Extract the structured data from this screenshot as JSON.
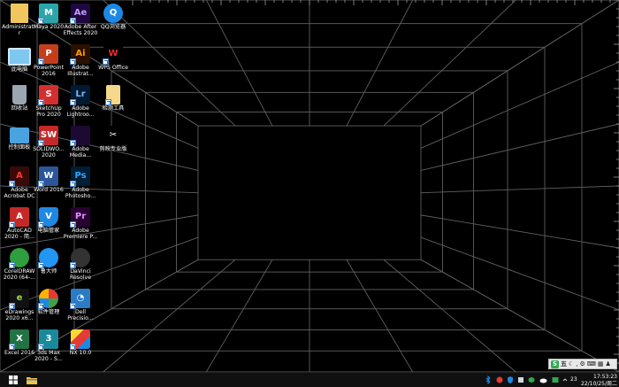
{
  "desktop": {
    "icons": [
      {
        "id": "administrator",
        "label": "Administrato\nr",
        "glyph": "",
        "bg": "#f0c75e",
        "fg": "#5a3a10",
        "shape": "folder-user",
        "col": 0,
        "row": 0,
        "shortcut": false
      },
      {
        "id": "maya",
        "label": "Maya 2020",
        "glyph": "M",
        "bg": "#2aa6a8",
        "fg": "#ffffff",
        "shape": "tile",
        "col": 1,
        "row": 0,
        "shortcut": true
      },
      {
        "id": "after-effects",
        "label": "Adobe After\nEffects 2020",
        "glyph": "Ae",
        "bg": "#1f0740",
        "fg": "#c49cff",
        "shape": "tile",
        "col": 2,
        "row": 0,
        "shortcut": true
      },
      {
        "id": "qq-browser",
        "label": "QQ浏览器",
        "glyph": "Q",
        "bg": "#1e88e5",
        "fg": "#ffffff",
        "shape": "round",
        "col": 3,
        "row": 0,
        "shortcut": false
      },
      {
        "id": "this-pc",
        "label": "此电脑",
        "glyph": "",
        "bg": "#7ec8f0",
        "fg": "#1c4f7a",
        "shape": "monitor",
        "col": 0,
        "row": 1,
        "shortcut": false
      },
      {
        "id": "powerpoint",
        "label": "PowerPoint\n2016",
        "glyph": "P",
        "bg": "#c43e1c",
        "fg": "#ffffff",
        "shape": "tile",
        "col": 1,
        "row": 1,
        "shortcut": true
      },
      {
        "id": "illustrator",
        "label": "Adobe\nIllustrat...",
        "glyph": "Ai",
        "bg": "#2b1000",
        "fg": "#ff9a00",
        "shape": "tile",
        "col": 2,
        "row": 1,
        "shortcut": true
      },
      {
        "id": "wps-office",
        "label": "WPS Office",
        "glyph": "W",
        "bg": "#000000",
        "fg": "#e5322d",
        "shape": "tile",
        "col": 3,
        "row": 1,
        "shortcut": true
      },
      {
        "id": "recycle-bin",
        "label": "回收站",
        "glyph": "",
        "bg": "#9aa6b2",
        "fg": "#3a4450",
        "shape": "bin",
        "col": 0,
        "row": 2,
        "shortcut": false
      },
      {
        "id": "sketchup",
        "label": "SketchUp\nPro 2020",
        "glyph": "S",
        "bg": "#d32f2f",
        "fg": "#ffffff",
        "shape": "tile",
        "col": 1,
        "row": 2,
        "shortcut": true
      },
      {
        "id": "lightroom",
        "label": "Adobe\nLightroo...",
        "glyph": "Lr",
        "bg": "#001a33",
        "fg": "#7ab8ff",
        "shape": "tile",
        "col": 2,
        "row": 2,
        "shortcut": true
      },
      {
        "id": "network-tool",
        "label": "检测工具",
        "glyph": "",
        "bg": "#f5d88a",
        "fg": "#7a5a10",
        "shape": "doc",
        "col": 3,
        "row": 2,
        "shortcut": true
      },
      {
        "id": "control-panel",
        "label": "控制面板",
        "glyph": "",
        "bg": "#4aa3df",
        "fg": "#ffffff",
        "shape": "panel",
        "col": 0,
        "row": 3,
        "shortcut": false
      },
      {
        "id": "solidworks",
        "label": "SOLIDWO...\n2020",
        "glyph": "SW",
        "bg": "#c62828",
        "fg": "#ffffff",
        "shape": "tile",
        "col": 1,
        "row": 3,
        "shortcut": true
      },
      {
        "id": "media-encoder",
        "label": "Adobe\nMedia...",
        "glyph": "",
        "bg": "#1d0a33",
        "fg": "#a88cff",
        "shape": "tile",
        "col": 2,
        "row": 3,
        "shortcut": true
      },
      {
        "id": "capcut",
        "label": "剪映专业版",
        "glyph": "✂",
        "bg": "#000000",
        "fg": "#ffffff",
        "shape": "tile",
        "col": 3,
        "row": 3,
        "shortcut": false
      },
      {
        "id": "acrobat",
        "label": "Adobe\nAcrobat DC",
        "glyph": "A",
        "bg": "#3a0a0a",
        "fg": "#ff3b30",
        "shape": "tile",
        "col": 0,
        "row": 4,
        "shortcut": true
      },
      {
        "id": "word",
        "label": "Word 2016",
        "glyph": "W",
        "bg": "#2b579a",
        "fg": "#ffffff",
        "shape": "tile",
        "col": 1,
        "row": 4,
        "shortcut": true
      },
      {
        "id": "photoshop",
        "label": "Adobe\nPhotosho...",
        "glyph": "Ps",
        "bg": "#001e36",
        "fg": "#31a8ff",
        "shape": "tile",
        "col": 2,
        "row": 4,
        "shortcut": true
      },
      {
        "id": "autocad",
        "label": "AutoCAD\n2020 - 简...",
        "glyph": "A",
        "bg": "#c62828",
        "fg": "#ffffff",
        "shape": "tile",
        "col": 0,
        "row": 5,
        "shortcut": true
      },
      {
        "id": "pc-manager",
        "label": "电脑管家",
        "glyph": "V",
        "bg": "#1e88e5",
        "fg": "#ffffff",
        "shape": "shield",
        "col": 1,
        "row": 5,
        "shortcut": true
      },
      {
        "id": "premiere",
        "label": "Adobe\nPremiere P...",
        "glyph": "Pr",
        "bg": "#2a0033",
        "fg": "#e38cff",
        "shape": "tile",
        "col": 2,
        "row": 5,
        "shortcut": true
      },
      {
        "id": "coreldraw",
        "label": "CorelDRAW\n2020 (64-...",
        "glyph": "",
        "bg": "#2e9e3e",
        "fg": "#ffffff",
        "shape": "round",
        "col": 0,
        "row": 6,
        "shortcut": true
      },
      {
        "id": "ludashi",
        "label": "鲁大师",
        "glyph": "",
        "bg": "#2196f3",
        "fg": "#ffffff",
        "shape": "round",
        "col": 1,
        "row": 6,
        "shortcut": true
      },
      {
        "id": "davinci",
        "label": "DaVinci\nResolve",
        "glyph": "",
        "bg": "#333333",
        "fg": "#ffffff",
        "shape": "round",
        "col": 2,
        "row": 6,
        "shortcut": true
      },
      {
        "id": "edrawings",
        "label": "eDrawings\n2020 x6...",
        "glyph": "e",
        "bg": "#111111",
        "fg": "#9bd84f",
        "shape": "tile",
        "col": 0,
        "row": 7,
        "shortcut": true
      },
      {
        "id": "software-manager",
        "label": "软件管理",
        "glyph": "",
        "bg": "#ffb300",
        "fg": "#ffffff",
        "shape": "petals",
        "col": 1,
        "row": 7,
        "shortcut": true
      },
      {
        "id": "dell-precision",
        "label": "Dell\nPrecisio...",
        "glyph": "◔",
        "bg": "#2a7cc7",
        "fg": "#ffffff",
        "shape": "tile",
        "col": 2,
        "row": 7,
        "shortcut": true
      },
      {
        "id": "excel",
        "label": "Excel 2016",
        "glyph": "X",
        "bg": "#217346",
        "fg": "#ffffff",
        "shape": "tile",
        "col": 0,
        "row": 8,
        "shortcut": true
      },
      {
        "id": "3ds-max",
        "label": "3ds Max\n2020 - S...",
        "glyph": "3",
        "bg": "#1a8a9a",
        "fg": "#ffffff",
        "shape": "tile",
        "col": 1,
        "row": 8,
        "shortcut": true
      },
      {
        "id": "nx",
        "label": "NX 10.0",
        "glyph": "",
        "bg": "#e53935",
        "fg": "#ffffff",
        "shape": "nx",
        "col": 2,
        "row": 8,
        "shortcut": true
      }
    ]
  },
  "ime": {
    "mode": "五",
    "icons": [
      "moon-icon",
      "comma-icon",
      "gear-icon",
      "keyboard-icon",
      "grid-icon",
      "user-icon"
    ]
  },
  "taskbar": {
    "tray": {
      "temperature": "23",
      "time": "17:53:23",
      "date": "22/10/25/周二"
    }
  },
  "colors": {
    "grid_line": "#6b6b6b",
    "taskbar": "#101010",
    "accent": "#1e88e5"
  }
}
